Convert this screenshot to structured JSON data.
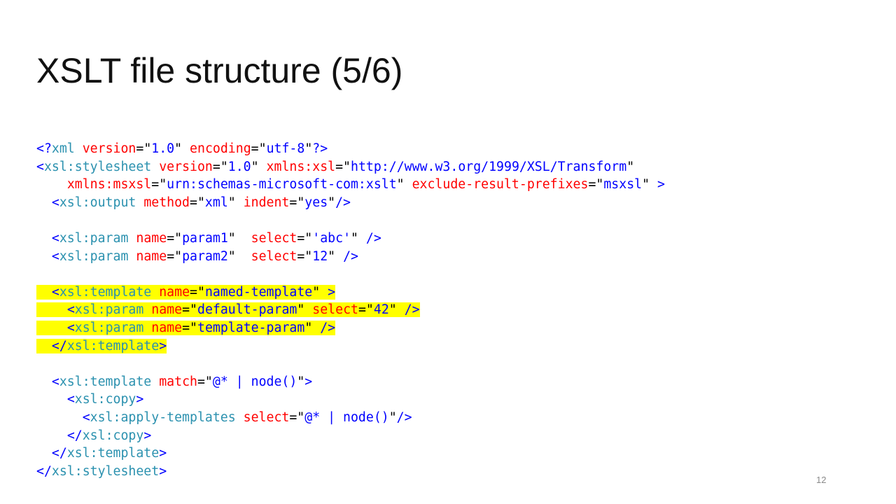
{
  "slide": {
    "title": "XSLT file structure (5/6)",
    "page_number": "12"
  },
  "colors": {
    "punct": "#0000ff",
    "element": "#2b91af",
    "attribute": "#ff0000",
    "value": "#0000ff",
    "text": "#000000",
    "highlight": "#ffff00"
  },
  "code_lines": [
    {
      "highlight": false,
      "tokens": [
        {
          "t": "<?",
          "c": "punct"
        },
        {
          "t": "xml",
          "c": "element"
        },
        {
          "t": " ",
          "c": "text"
        },
        {
          "t": "version",
          "c": "attribute"
        },
        {
          "t": "=\"",
          "c": "text"
        },
        {
          "t": "1.0",
          "c": "value"
        },
        {
          "t": "\" ",
          "c": "text"
        },
        {
          "t": "encoding",
          "c": "attribute"
        },
        {
          "t": "=\"",
          "c": "text"
        },
        {
          "t": "utf-8",
          "c": "value"
        },
        {
          "t": "\"",
          "c": "text"
        },
        {
          "t": "?>",
          "c": "punct"
        }
      ]
    },
    {
      "highlight": false,
      "tokens": [
        {
          "t": "<",
          "c": "punct"
        },
        {
          "t": "xsl:stylesheet",
          "c": "element"
        },
        {
          "t": " ",
          "c": "text"
        },
        {
          "t": "version",
          "c": "attribute"
        },
        {
          "t": "=\"",
          "c": "text"
        },
        {
          "t": "1.0",
          "c": "value"
        },
        {
          "t": "\" ",
          "c": "text"
        },
        {
          "t": "xmlns:xsl",
          "c": "attribute"
        },
        {
          "t": "=\"",
          "c": "text"
        },
        {
          "t": "http://www.w3.org/1999/XSL/Transform",
          "c": "value"
        },
        {
          "t": "\"",
          "c": "text"
        }
      ]
    },
    {
      "highlight": false,
      "tokens": [
        {
          "t": "    ",
          "c": "text"
        },
        {
          "t": "xmlns:msxsl",
          "c": "attribute"
        },
        {
          "t": "=\"",
          "c": "text"
        },
        {
          "t": "urn:schemas-microsoft-com:xslt",
          "c": "value"
        },
        {
          "t": "\" ",
          "c": "text"
        },
        {
          "t": "exclude-result-prefixes",
          "c": "attribute"
        },
        {
          "t": "=\"",
          "c": "text"
        },
        {
          "t": "msxsl",
          "c": "value"
        },
        {
          "t": "\" ",
          "c": "text"
        },
        {
          "t": ">",
          "c": "punct"
        }
      ]
    },
    {
      "highlight": false,
      "tokens": [
        {
          "t": "  ",
          "c": "text"
        },
        {
          "t": "<",
          "c": "punct"
        },
        {
          "t": "xsl:output",
          "c": "element"
        },
        {
          "t": " ",
          "c": "text"
        },
        {
          "t": "method",
          "c": "attribute"
        },
        {
          "t": "=\"",
          "c": "text"
        },
        {
          "t": "xml",
          "c": "value"
        },
        {
          "t": "\" ",
          "c": "text"
        },
        {
          "t": "indent",
          "c": "attribute"
        },
        {
          "t": "=\"",
          "c": "text"
        },
        {
          "t": "yes",
          "c": "value"
        },
        {
          "t": "\"",
          "c": "text"
        },
        {
          "t": "/>",
          "c": "punct"
        }
      ]
    },
    {
      "highlight": false,
      "tokens": []
    },
    {
      "highlight": false,
      "tokens": [
        {
          "t": "  ",
          "c": "text"
        },
        {
          "t": "<",
          "c": "punct"
        },
        {
          "t": "xsl:param",
          "c": "element"
        },
        {
          "t": " ",
          "c": "text"
        },
        {
          "t": "name",
          "c": "attribute"
        },
        {
          "t": "=\"",
          "c": "text"
        },
        {
          "t": "param1",
          "c": "value"
        },
        {
          "t": "\"  ",
          "c": "text"
        },
        {
          "t": "select",
          "c": "attribute"
        },
        {
          "t": "=\"",
          "c": "text"
        },
        {
          "t": "'abc'",
          "c": "value"
        },
        {
          "t": "\" ",
          "c": "text"
        },
        {
          "t": "/>",
          "c": "punct"
        }
      ]
    },
    {
      "highlight": false,
      "tokens": [
        {
          "t": "  ",
          "c": "text"
        },
        {
          "t": "<",
          "c": "punct"
        },
        {
          "t": "xsl:param",
          "c": "element"
        },
        {
          "t": " ",
          "c": "text"
        },
        {
          "t": "name",
          "c": "attribute"
        },
        {
          "t": "=\"",
          "c": "text"
        },
        {
          "t": "param2",
          "c": "value"
        },
        {
          "t": "\"  ",
          "c": "text"
        },
        {
          "t": "select",
          "c": "attribute"
        },
        {
          "t": "=\"",
          "c": "text"
        },
        {
          "t": "12",
          "c": "value"
        },
        {
          "t": "\" ",
          "c": "text"
        },
        {
          "t": "/>",
          "c": "punct"
        }
      ]
    },
    {
      "highlight": false,
      "tokens": []
    },
    {
      "highlight": true,
      "tokens": [
        {
          "t": "  ",
          "c": "text"
        },
        {
          "t": "<",
          "c": "punct"
        },
        {
          "t": "xsl:template",
          "c": "element"
        },
        {
          "t": " ",
          "c": "text"
        },
        {
          "t": "name",
          "c": "attribute"
        },
        {
          "t": "=\"",
          "c": "text"
        },
        {
          "t": "named-template",
          "c": "value"
        },
        {
          "t": "\" ",
          "c": "text"
        },
        {
          "t": ">",
          "c": "punct"
        }
      ]
    },
    {
      "highlight": true,
      "tokens": [
        {
          "t": "    ",
          "c": "text"
        },
        {
          "t": "<",
          "c": "punct"
        },
        {
          "t": "xsl:param",
          "c": "element"
        },
        {
          "t": " ",
          "c": "text"
        },
        {
          "t": "name",
          "c": "attribute"
        },
        {
          "t": "=\"",
          "c": "text"
        },
        {
          "t": "default-param",
          "c": "value"
        },
        {
          "t": "\" ",
          "c": "text"
        },
        {
          "t": "select",
          "c": "attribute"
        },
        {
          "t": "=\"",
          "c": "text"
        },
        {
          "t": "42",
          "c": "value"
        },
        {
          "t": "\" ",
          "c": "text"
        },
        {
          "t": "/>",
          "c": "punct"
        }
      ]
    },
    {
      "highlight": true,
      "tokens": [
        {
          "t": "    ",
          "c": "text"
        },
        {
          "t": "<",
          "c": "punct"
        },
        {
          "t": "xsl:param",
          "c": "element"
        },
        {
          "t": " ",
          "c": "text"
        },
        {
          "t": "name",
          "c": "attribute"
        },
        {
          "t": "=\"",
          "c": "text"
        },
        {
          "t": "template-param",
          "c": "value"
        },
        {
          "t": "\" ",
          "c": "text"
        },
        {
          "t": "/>",
          "c": "punct"
        }
      ]
    },
    {
      "highlight": true,
      "tokens": [
        {
          "t": "  ",
          "c": "text"
        },
        {
          "t": "</",
          "c": "punct"
        },
        {
          "t": "xsl:template",
          "c": "element"
        },
        {
          "t": ">",
          "c": "punct"
        }
      ]
    },
    {
      "highlight": false,
      "tokens": []
    },
    {
      "highlight": false,
      "tokens": [
        {
          "t": "  ",
          "c": "text"
        },
        {
          "t": "<",
          "c": "punct"
        },
        {
          "t": "xsl:template",
          "c": "element"
        },
        {
          "t": " ",
          "c": "text"
        },
        {
          "t": "match",
          "c": "attribute"
        },
        {
          "t": "=\"",
          "c": "text"
        },
        {
          "t": "@* | node()",
          "c": "value"
        },
        {
          "t": "\"",
          "c": "text"
        },
        {
          "t": ">",
          "c": "punct"
        }
      ]
    },
    {
      "highlight": false,
      "tokens": [
        {
          "t": "    ",
          "c": "text"
        },
        {
          "t": "<",
          "c": "punct"
        },
        {
          "t": "xsl:copy",
          "c": "element"
        },
        {
          "t": ">",
          "c": "punct"
        }
      ]
    },
    {
      "highlight": false,
      "tokens": [
        {
          "t": "      ",
          "c": "text"
        },
        {
          "t": "<",
          "c": "punct"
        },
        {
          "t": "xsl:apply-templates",
          "c": "element"
        },
        {
          "t": " ",
          "c": "text"
        },
        {
          "t": "select",
          "c": "attribute"
        },
        {
          "t": "=\"",
          "c": "text"
        },
        {
          "t": "@* | node()",
          "c": "value"
        },
        {
          "t": "\"",
          "c": "text"
        },
        {
          "t": "/>",
          "c": "punct"
        }
      ]
    },
    {
      "highlight": false,
      "tokens": [
        {
          "t": "    ",
          "c": "text"
        },
        {
          "t": "</",
          "c": "punct"
        },
        {
          "t": "xsl:copy",
          "c": "element"
        },
        {
          "t": ">",
          "c": "punct"
        }
      ]
    },
    {
      "highlight": false,
      "tokens": [
        {
          "t": "  ",
          "c": "text"
        },
        {
          "t": "</",
          "c": "punct"
        },
        {
          "t": "xsl:template",
          "c": "element"
        },
        {
          "t": ">",
          "c": "punct"
        }
      ]
    },
    {
      "highlight": false,
      "tokens": [
        {
          "t": "</",
          "c": "punct"
        },
        {
          "t": "xsl:stylesheet",
          "c": "element"
        },
        {
          "t": ">",
          "c": "punct"
        }
      ]
    }
  ]
}
